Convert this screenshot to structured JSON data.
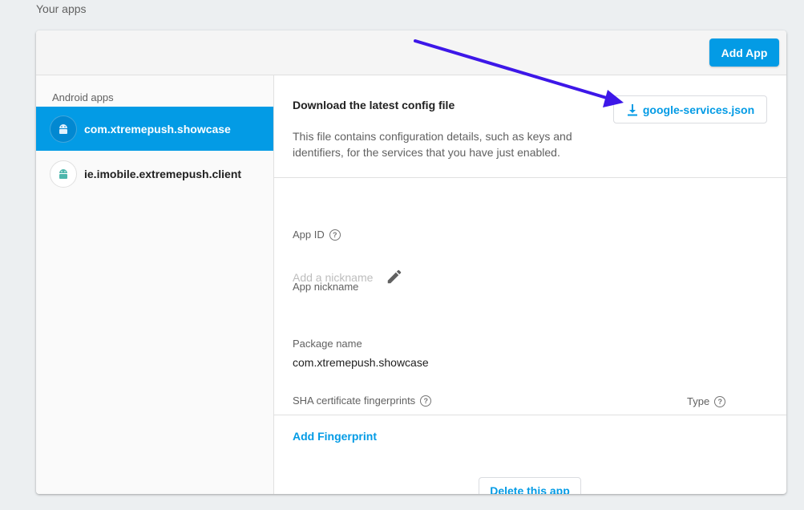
{
  "page": {
    "section_label": "Your apps"
  },
  "header": {
    "add_app_label": "Add App"
  },
  "sidebar": {
    "heading": "Android apps",
    "items": [
      {
        "label": "com.xtremepush.showcase",
        "active": true
      },
      {
        "label": "ie.imobile.extremepush.client",
        "active": false
      }
    ]
  },
  "config": {
    "title": "Download the latest config file",
    "description": "This file contains configuration details, such as keys and identifiers, for the services that you have just enabled.",
    "download_label": "google-services.json"
  },
  "details": {
    "app_id_label": "App ID",
    "nickname_label": "App nickname",
    "nickname_placeholder": "Add a nickname",
    "package_label": "Package name",
    "package_value": "com.xtremepush.showcase",
    "sha_label": "SHA certificate fingerprints",
    "type_label": "Type",
    "add_fingerprint_label": "Add Fingerprint",
    "delete_label": "Delete this app"
  },
  "icons": {
    "help": "?",
    "android": "android-icon",
    "download": "download-icon",
    "edit": "pencil-icon"
  },
  "colors": {
    "accent": "#039be5",
    "annotation_arrow": "#3d17e8"
  }
}
